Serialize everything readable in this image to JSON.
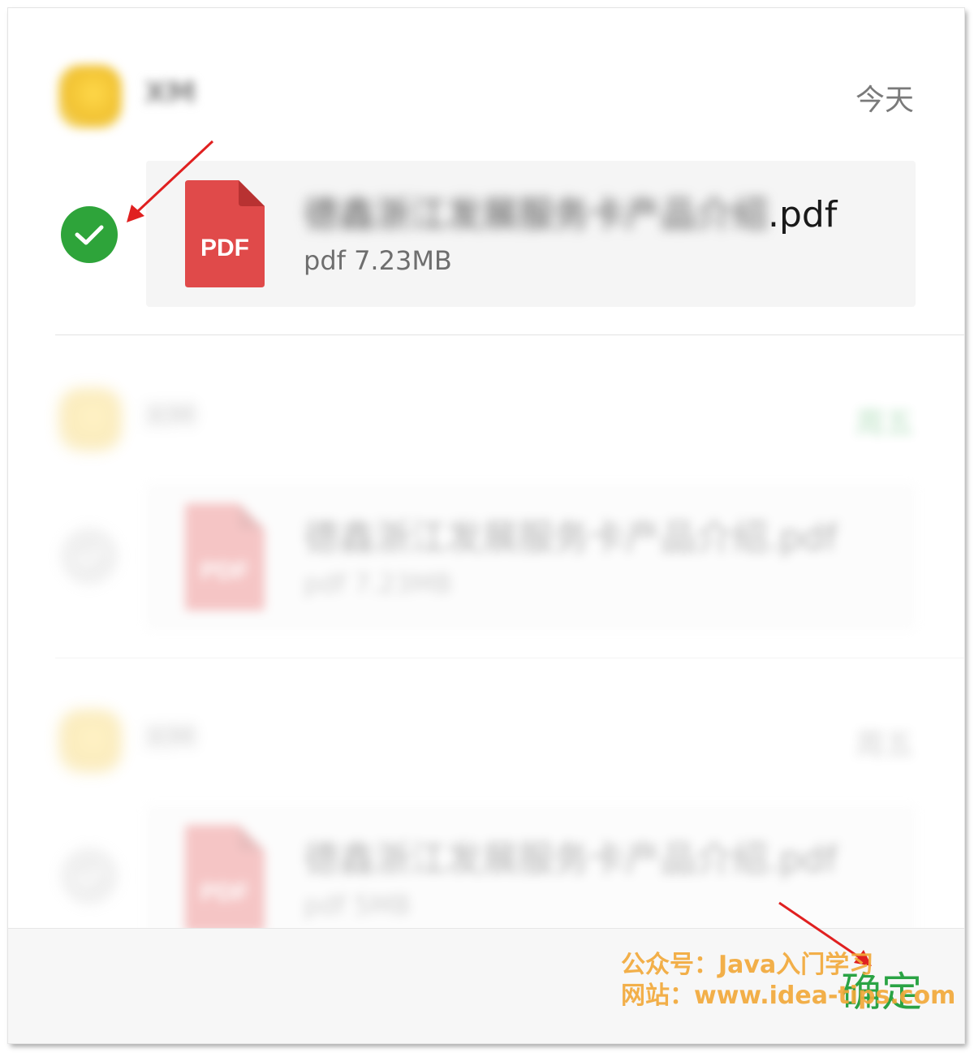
{
  "messages": [
    {
      "sender": "XM",
      "time": "今天",
      "file_name_blurred": "德鑫浙江发展服务卡产品介绍",
      "file_ext": ".pdf",
      "file_meta": "pdf 7.23MB",
      "pdf_label": "PDF",
      "selected": true
    },
    {
      "sender": "XM",
      "time": "周五",
      "file_name_blurred": "德鑫浙江发展服务卡产品介绍.pdf",
      "file_ext": "",
      "file_meta": "pdf 7.23MB",
      "pdf_label": "PDF",
      "selected": false
    },
    {
      "sender": "XM",
      "time": "周五",
      "file_name_blurred": "德鑫浙江发展服务卡产品介绍.pdf",
      "file_ext": "",
      "file_meta": "pdf 5MB",
      "pdf_label": "PDF",
      "selected": false
    }
  ],
  "bottom_bar": {
    "confirm_label": "确定"
  },
  "watermark": {
    "line1": "公众号：Java入门学习",
    "line2": "网站：www.idea-tips.com"
  },
  "colors": {
    "accent": "#2aa344",
    "pdf": "#e04a4a",
    "check": "#2ea43a",
    "annotation": "#e02020"
  },
  "icons": {
    "check": "checkmark-icon",
    "pdf": "pdf-file-icon"
  }
}
